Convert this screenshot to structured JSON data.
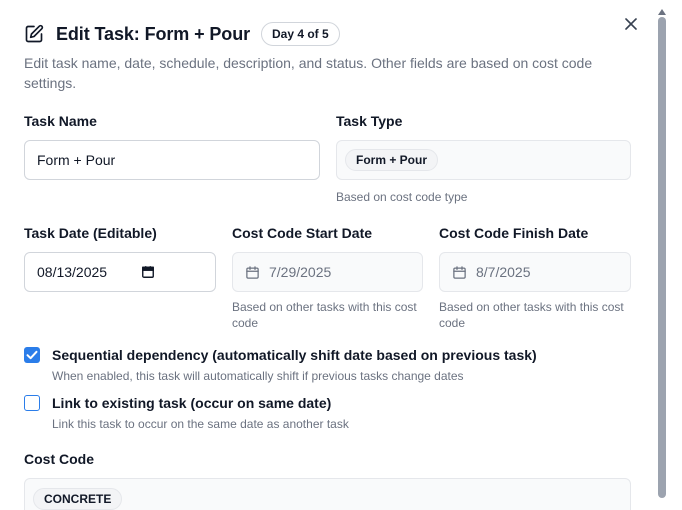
{
  "dialog": {
    "title": "Edit Task: Form + Pour",
    "badge": "Day 4 of 5",
    "description": "Edit task name, date, schedule, description, and status. Other fields are based on cost code settings."
  },
  "icons": {
    "edit": "pencil-square-icon",
    "close": "close-icon",
    "calendar": "calendar-icon"
  },
  "fields": {
    "task_name": {
      "label": "Task Name",
      "value": "Form + Pour"
    },
    "task_type": {
      "label": "Task Type",
      "chip": "Form + Pour",
      "help": "Based on cost code type"
    },
    "task_date": {
      "label": "Task Date (Editable)",
      "value": "08/13/2025"
    },
    "start_date": {
      "label": "Cost Code Start Date",
      "value": "7/29/2025",
      "help": "Based on other tasks with this cost code"
    },
    "finish_date": {
      "label": "Cost Code Finish Date",
      "value": "8/7/2025",
      "help": "Based on other tasks with this cost code"
    }
  },
  "options": {
    "sequential": {
      "label": "Sequential dependency (automatically shift date based on previous task)",
      "help": "When enabled, this task will automatically shift if previous tasks change dates",
      "checked": true
    },
    "link_existing": {
      "label": "Link to existing task (occur on same date)",
      "help": "Link this task to occur on the same date as another task",
      "checked": false
    }
  },
  "cost_code": {
    "label": "Cost Code",
    "chip": "CONCRETE"
  },
  "colors": {
    "accent": "#2b7de9",
    "muted": "#6b7280",
    "border": "#d1d5db"
  }
}
